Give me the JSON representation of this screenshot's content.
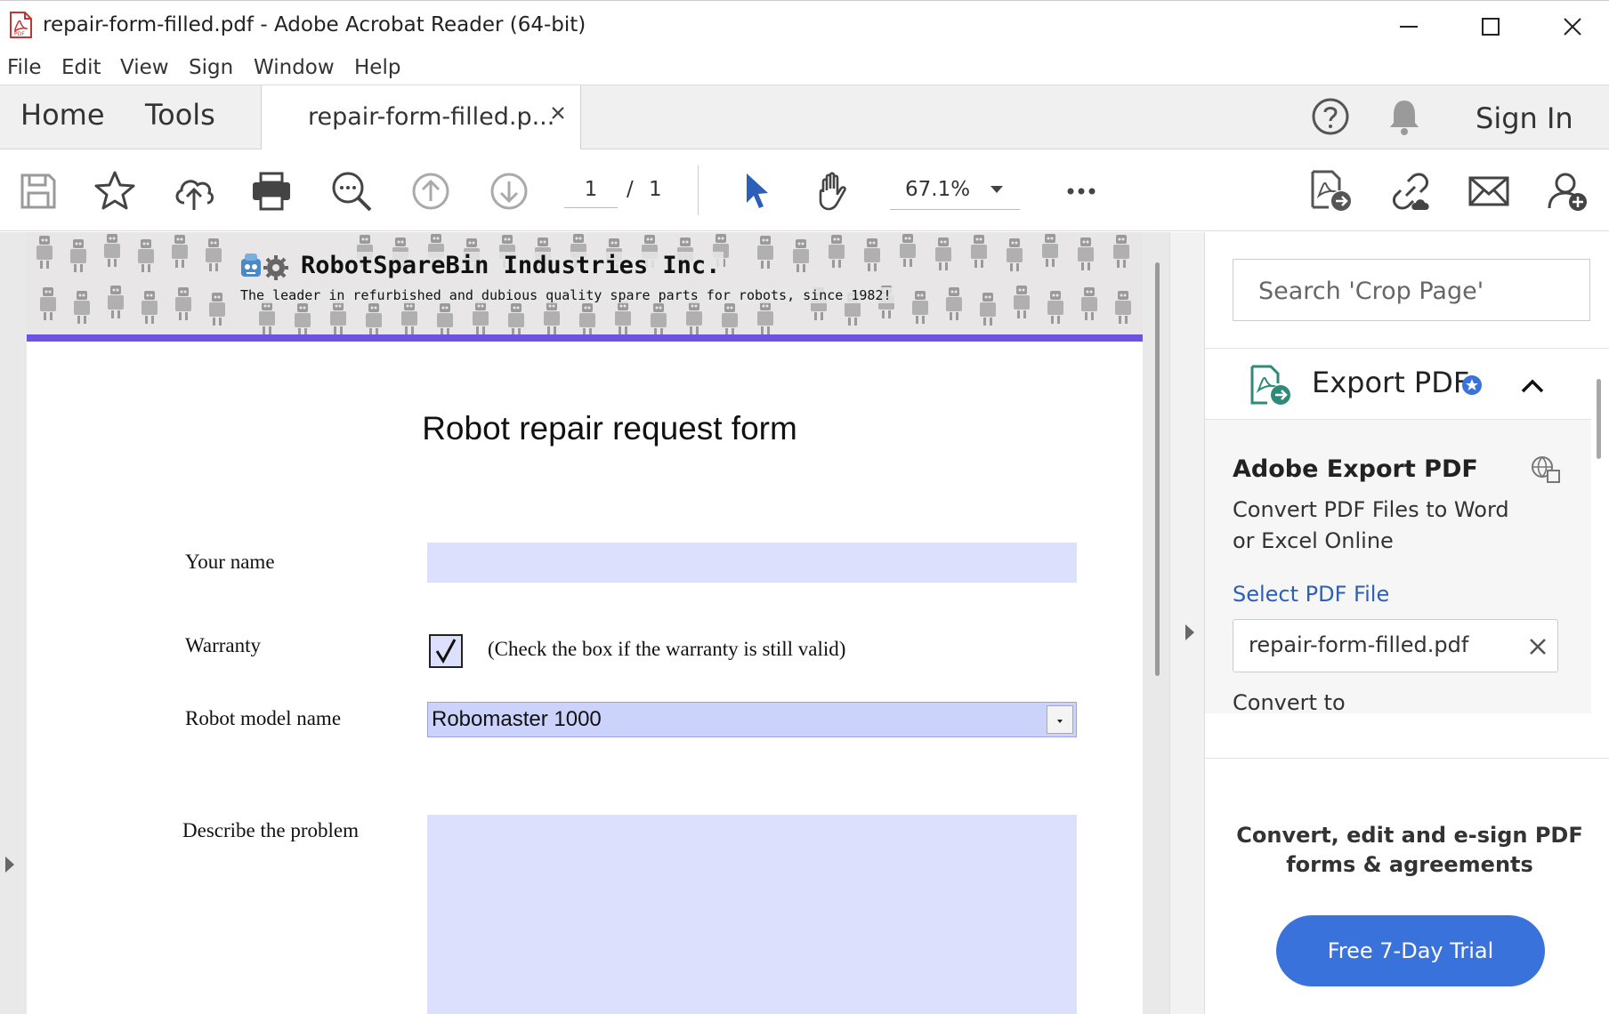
{
  "window": {
    "title": "repair-form-filled.pdf - Adobe Acrobat Reader (64-bit)",
    "app_icon": "acrobat-pdf-icon",
    "controls": [
      "minimize-icon",
      "maximize-icon",
      "close-icon"
    ]
  },
  "menubar": {
    "items": [
      "File",
      "Edit",
      "View",
      "Sign",
      "Window",
      "Help"
    ]
  },
  "tabs": {
    "home": "Home",
    "tools": "Tools",
    "document_tab": "repair-form-filled.p...",
    "sign_in": "Sign In"
  },
  "toolbar": {
    "icons": [
      "save-icon",
      "bookmark-star-icon",
      "cloud-upload-icon",
      "print-icon",
      "zoom-out-icon",
      "previous-page-icon",
      "next-page-icon",
      "select-cursor-icon",
      "hand-tool-icon",
      "more-options-icon",
      "export-pdf-icon",
      "share-link-icon",
      "email-icon",
      "add-user-icon"
    ],
    "current_page": "1",
    "page_separator": "/",
    "total_pages": "1",
    "zoom": "67.1%"
  },
  "document": {
    "banner_title": "RobotSpareBin Industries Inc.",
    "banner_tagline": "The leader in refurbished and dubious quality spare parts for robots, since 1982!",
    "form_title": "Robot repair request form",
    "fields": {
      "your_name_label": "Your name",
      "your_name_value": "",
      "warranty_label": "Warranty",
      "warranty_checked": true,
      "warranty_check_mark": "✓",
      "warranty_note": "(Check the box if the warranty is still valid)",
      "robot_model_label": "Robot model name",
      "robot_model_value": "Robomaster 1000",
      "problem_label": "Describe the problem",
      "problem_value": ""
    },
    "accent_color": "#6f53e0",
    "field_color": "#dde0fc"
  },
  "right_pane": {
    "search_placeholder": "Search 'Crop Page'",
    "section_title": "Export PDF",
    "panel": {
      "title": "Adobe Export PDF",
      "description": "Convert PDF Files to Word or Excel Online",
      "select_link": "Select PDF File",
      "selected_file": "repair-form-filled.pdf",
      "convert_to_label": "Convert to"
    },
    "promo": {
      "text": "Convert, edit and e-sign PDF forms & agreements",
      "button": "Free 7-Day Trial"
    },
    "button_color": "#3a72dc",
    "link_color": "#2c5fb8"
  }
}
